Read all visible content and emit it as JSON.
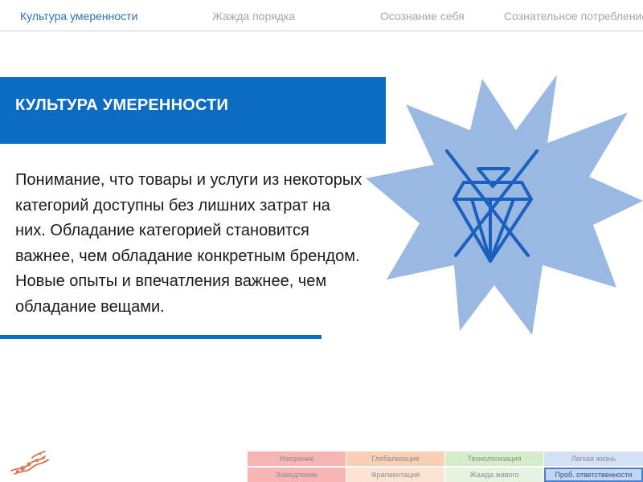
{
  "nav": {
    "tabs": [
      {
        "label": "Культура умеренности",
        "active": true
      },
      {
        "label": "Жажда порядка"
      },
      {
        "label": "Осознание себя"
      },
      {
        "label": "Сознательное потребление"
      }
    ]
  },
  "banner": {
    "title": "КУЛЬТУРА УМЕРЕННОСТИ"
  },
  "description": {
    "lines": [
      "Понимание, что товары и услуги из некоторых",
      "категорий доступны без лишних затрат на",
      "них. Обладание категорией становится",
      "важнее, чем обладание конкретным брендом.",
      "Новые опыты  и впечатления важнее, чем",
      "обладание вещами."
    ]
  },
  "emblem": {
    "icon": "crossed-diamond-icon",
    "star_color": "#99b9e3",
    "icon_color": "#1b5fbf"
  },
  "colors": {
    "accent": "#0c6cc4",
    "active_tab": "#2e6fba",
    "inactive_tab": "#a6a6a6"
  },
  "trend_grid": {
    "rows": [
      [
        {
          "label": "Ускорение",
          "color": "#f7b5b5"
        },
        {
          "label": "Глобализация",
          "color": "#f9cfb6"
        },
        {
          "label": "Технологизация",
          "color": "#d5edc9"
        },
        {
          "label": "Легкая жизнь",
          "color": "#d3e1f5"
        }
      ],
      [
        {
          "label": "Замедление",
          "color": "#f7b5b5"
        },
        {
          "label": "Фрагментация",
          "color": "#fce3d3"
        },
        {
          "label": "Жажда живого",
          "color": "#e6f4df"
        },
        {
          "label": "Проб. ответственности",
          "color": "#c2d5f1",
          "selected": true
        }
      ]
    ]
  }
}
